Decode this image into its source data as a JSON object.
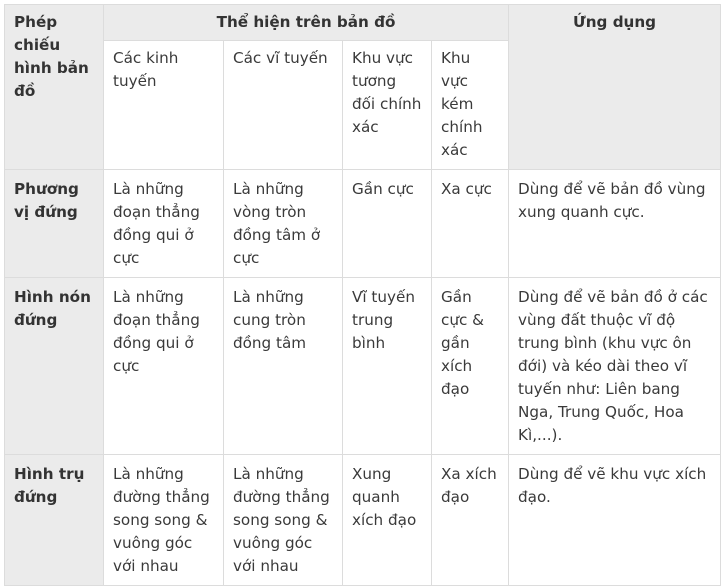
{
  "table": {
    "headers": {
      "projection": "Phép chiếu hình bản đồ",
      "shown_on_map": "Thể hiện trên bản đồ",
      "application": "Ứng dụng",
      "meridians": "Các kinh tuyến",
      "parallels": "Các vĩ tuyến",
      "accurate_area": "Khu vực tương đối chính xác",
      "inaccurate_area": "Khu vực kém chính xác"
    },
    "rows": [
      {
        "projection": "Phương vị đứng",
        "meridians": "Là những đoạn thẳng đồng qui ở cực",
        "parallels": "Là những vòng tròn đồng tâm ở cực",
        "accurate_area": "Gần cực",
        "inaccurate_area": "Xa cực",
        "application": "Dùng để vẽ bản đồ vùng xung quanh cực."
      },
      {
        "projection": "Hình nón đứng",
        "meridians": "Là những đoạn thẳng đồng qui ở cực",
        "parallels": "Là những cung tròn đồng tâm",
        "accurate_area": "Vĩ tuyến trung bình",
        "inaccurate_area": "Gần cực & gần xích đạo",
        "application": "Dùng để vẽ bản đồ ở các vùng đất thuộc vĩ độ trung bình (khu vực ôn đới) và kéo dài theo vĩ tuyến như: Liên bang Nga, Trung Quốc, Hoa Kì,...)."
      },
      {
        "projection": "Hình trụ đứng",
        "meridians": "Là những đường thẳng song song & vuông góc với nhau",
        "parallels": "Là những đường thẳng song song & vuông góc với nhau",
        "accurate_area": "Xung quanh xích đạo",
        "inaccurate_area": "Xa xích đạo",
        "application": "Dùng để vẽ khu vực xích đạo."
      }
    ]
  }
}
